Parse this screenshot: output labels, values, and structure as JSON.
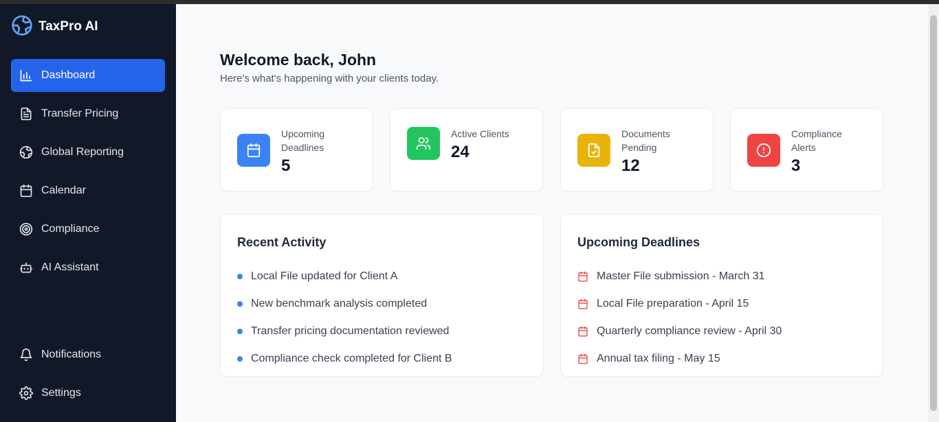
{
  "app": {
    "name": "TaxPro AI"
  },
  "sidebar": {
    "items": [
      {
        "label": "Dashboard",
        "icon": "bar-chart-icon",
        "active": true
      },
      {
        "label": "Transfer Pricing",
        "icon": "document-icon"
      },
      {
        "label": "Global Reporting",
        "icon": "globe-icon"
      },
      {
        "label": "Calendar",
        "icon": "calendar-icon"
      },
      {
        "label": "Compliance",
        "icon": "target-icon"
      },
      {
        "label": "AI Assistant",
        "icon": "bot-icon"
      }
    ],
    "bottom_items": [
      {
        "label": "Notifications",
        "icon": "bell-icon"
      },
      {
        "label": "Settings",
        "icon": "gear-icon"
      }
    ]
  },
  "header": {
    "title": "Welcome back, John",
    "subtitle": "Here's what's happening with your clients today."
  },
  "stats": [
    {
      "label": "Upcoming Deadlines",
      "value": "5",
      "icon": "calendar-icon",
      "color": "#3b82f6"
    },
    {
      "label": "Active Clients",
      "value": "24",
      "icon": "users-icon",
      "color": "#22c55e"
    },
    {
      "label": "Documents Pending",
      "value": "12",
      "icon": "file-check-icon",
      "color": "#eab308"
    },
    {
      "label": "Compliance Alerts",
      "value": "3",
      "icon": "alert-circle-icon",
      "color": "#ef4444"
    }
  ],
  "recent_activity": {
    "title": "Recent Activity",
    "items": [
      "Local File updated for Client A",
      "New benchmark analysis completed",
      "Transfer pricing documentation reviewed",
      "Compliance check completed for Client B"
    ]
  },
  "upcoming_deadlines": {
    "title": "Upcoming Deadlines",
    "items": [
      "Master File submission - March 31",
      "Local File preparation - April 15",
      "Quarterly compliance review - April 30",
      "Annual tax filing - May 15"
    ]
  },
  "colors": {
    "accent": "#2563eb",
    "sidebar_bg": "#111827",
    "deadline_icon": "#ef4444"
  }
}
